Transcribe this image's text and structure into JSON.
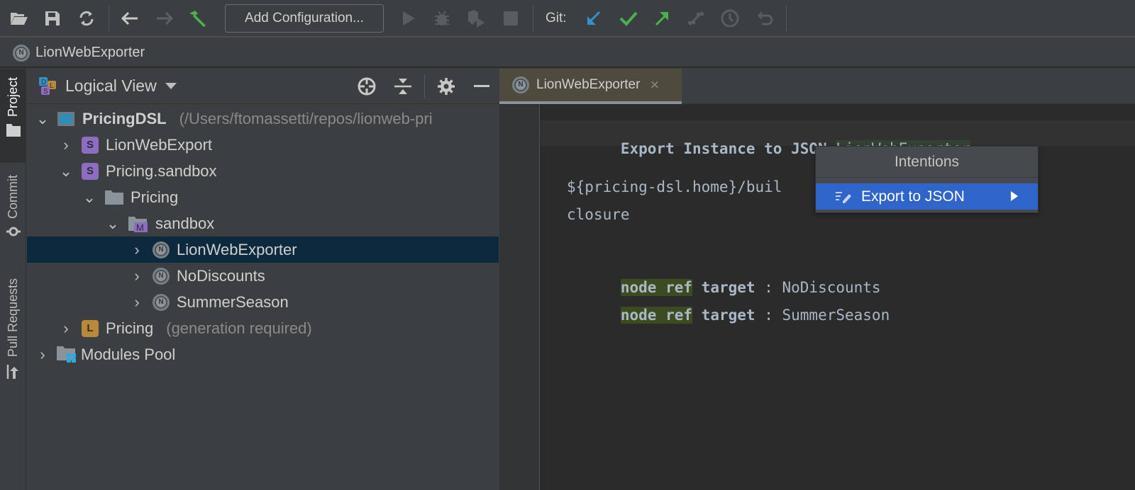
{
  "toolbar": {
    "add_configuration_label": "Add Configuration...",
    "git_label": "Git:",
    "icons": [
      "open-folder",
      "save",
      "sync",
      "back",
      "forward",
      "build-hammer",
      "run",
      "debug",
      "coverage",
      "stop",
      "git-update",
      "git-commit",
      "git-push",
      "git-compare",
      "git-history",
      "git-rollback"
    ],
    "colors": {
      "build": "#4caf50",
      "git_update": "#3592c4",
      "git_commit": "#4caf50",
      "git_push": "#4caf50"
    }
  },
  "navbar": {
    "breadcrumb": "LionWebExporter"
  },
  "left_stripe": {
    "items": [
      {
        "label": "Project",
        "active": true
      },
      {
        "label": "Commit",
        "active": false
      },
      {
        "label": "Pull Requests",
        "active": false
      }
    ]
  },
  "project_panel": {
    "view_label": "Logical View",
    "tree": [
      {
        "label": "PricingDSL",
        "detail": "(/Users/ftomassetti/repos/lionweb-pri",
        "icon": "project",
        "expanded": true,
        "depth": 0,
        "bold": true
      },
      {
        "label": "LionWebExport",
        "icon": "solution-s",
        "expanded": false,
        "depth": 1
      },
      {
        "label": "Pricing.sandbox",
        "icon": "solution-s",
        "expanded": true,
        "depth": 1
      },
      {
        "label": "Pricing",
        "icon": "folder",
        "expanded": true,
        "depth": 2
      },
      {
        "label": "sandbox",
        "icon": "model-folder",
        "expanded": true,
        "depth": 3
      },
      {
        "label": "LionWebExporter",
        "icon": "node-n",
        "expanded": false,
        "depth": 4,
        "selected": true
      },
      {
        "label": "NoDiscounts",
        "icon": "node-n",
        "expanded": false,
        "depth": 4
      },
      {
        "label": "SummerSeason",
        "icon": "node-n",
        "expanded": false,
        "depth": 4
      },
      {
        "label": "Pricing",
        "detail": "(generation required)",
        "icon": "language-l",
        "expanded": false,
        "depth": 1
      },
      {
        "label": "Modules Pool",
        "icon": "modules-pool",
        "expanded": false,
        "depth": 0
      }
    ]
  },
  "editor": {
    "tab_label": "LionWebExporter",
    "lines": {
      "l1_keyword": "Export Instance to JSON",
      "l1_name": "LionWebExporter",
      "l2": "${pricing-dsl.home}/buil",
      "l3": "closure",
      "l4_kw": "node ref",
      "l4_target": "target",
      "l4_sep": ":",
      "l4_value": "NoDiscounts",
      "l5_kw": "node ref",
      "l5_target": "target",
      "l5_sep": ":",
      "l5_value": "SummerSeason"
    }
  },
  "intentions_popup": {
    "title": "Intentions",
    "items": [
      {
        "label": "Export to JSON",
        "has_submenu": true,
        "selected": true
      }
    ]
  }
}
